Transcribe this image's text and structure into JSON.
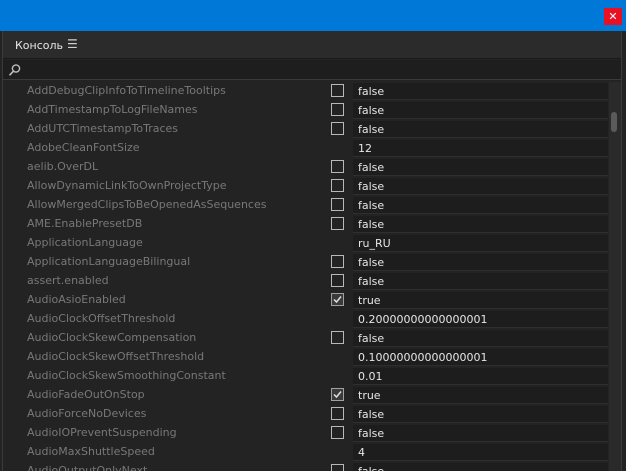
{
  "window": {
    "close_glyph": "✕"
  },
  "panel": {
    "tab_label": "Консоль",
    "menu_glyph": "☰"
  },
  "search": {
    "value": "",
    "placeholder": ""
  },
  "rows": [
    {
      "name": "AddDebugClipInfoToTimelineTooltips",
      "checkbox": true,
      "checked": false,
      "value": "false"
    },
    {
      "name": "AddTimestampToLogFileNames",
      "checkbox": true,
      "checked": false,
      "value": "false"
    },
    {
      "name": "AddUTCTimestampToTraces",
      "checkbox": true,
      "checked": false,
      "value": "false"
    },
    {
      "name": "AdobeCleanFontSize",
      "checkbox": false,
      "checked": false,
      "value": "12"
    },
    {
      "name": "aelib.OverDL",
      "checkbox": true,
      "checked": false,
      "value": "false"
    },
    {
      "name": "AllowDynamicLinkToOwnProjectType",
      "checkbox": true,
      "checked": false,
      "value": "false"
    },
    {
      "name": "AllowMergedClipsToBeOpenedAsSequences",
      "checkbox": true,
      "checked": false,
      "value": "false"
    },
    {
      "name": "AME.EnablePresetDB",
      "checkbox": true,
      "checked": false,
      "value": "false"
    },
    {
      "name": "ApplicationLanguage",
      "checkbox": false,
      "checked": false,
      "value": "ru_RU"
    },
    {
      "name": "ApplicationLanguageBilingual",
      "checkbox": true,
      "checked": false,
      "value": "false"
    },
    {
      "name": "assert.enabled",
      "checkbox": true,
      "checked": false,
      "value": "false"
    },
    {
      "name": "AudioAsioEnabled",
      "checkbox": true,
      "checked": true,
      "value": "true"
    },
    {
      "name": "AudioClockOffsetThreshold",
      "checkbox": false,
      "checked": false,
      "value": "0.20000000000000001"
    },
    {
      "name": "AudioClockSkewCompensation",
      "checkbox": true,
      "checked": false,
      "value": "false"
    },
    {
      "name": "AudioClockSkewOffsetThreshold",
      "checkbox": false,
      "checked": false,
      "value": "0.10000000000000001"
    },
    {
      "name": "AudioClockSkewSmoothingConstant",
      "checkbox": false,
      "checked": false,
      "value": "0.01"
    },
    {
      "name": "AudioFadeOutOnStop",
      "checkbox": true,
      "checked": true,
      "value": "true"
    },
    {
      "name": "AudioForceNoDevices",
      "checkbox": true,
      "checked": false,
      "value": "false"
    },
    {
      "name": "AudioIOPreventSuspending",
      "checkbox": true,
      "checked": false,
      "value": "false"
    },
    {
      "name": "AudioMaxShuttleSpeed",
      "checkbox": false,
      "checked": false,
      "value": "4"
    },
    {
      "name": "AudioOutputOnlyNext",
      "checkbox": true,
      "checked": false,
      "value": "false"
    }
  ]
}
